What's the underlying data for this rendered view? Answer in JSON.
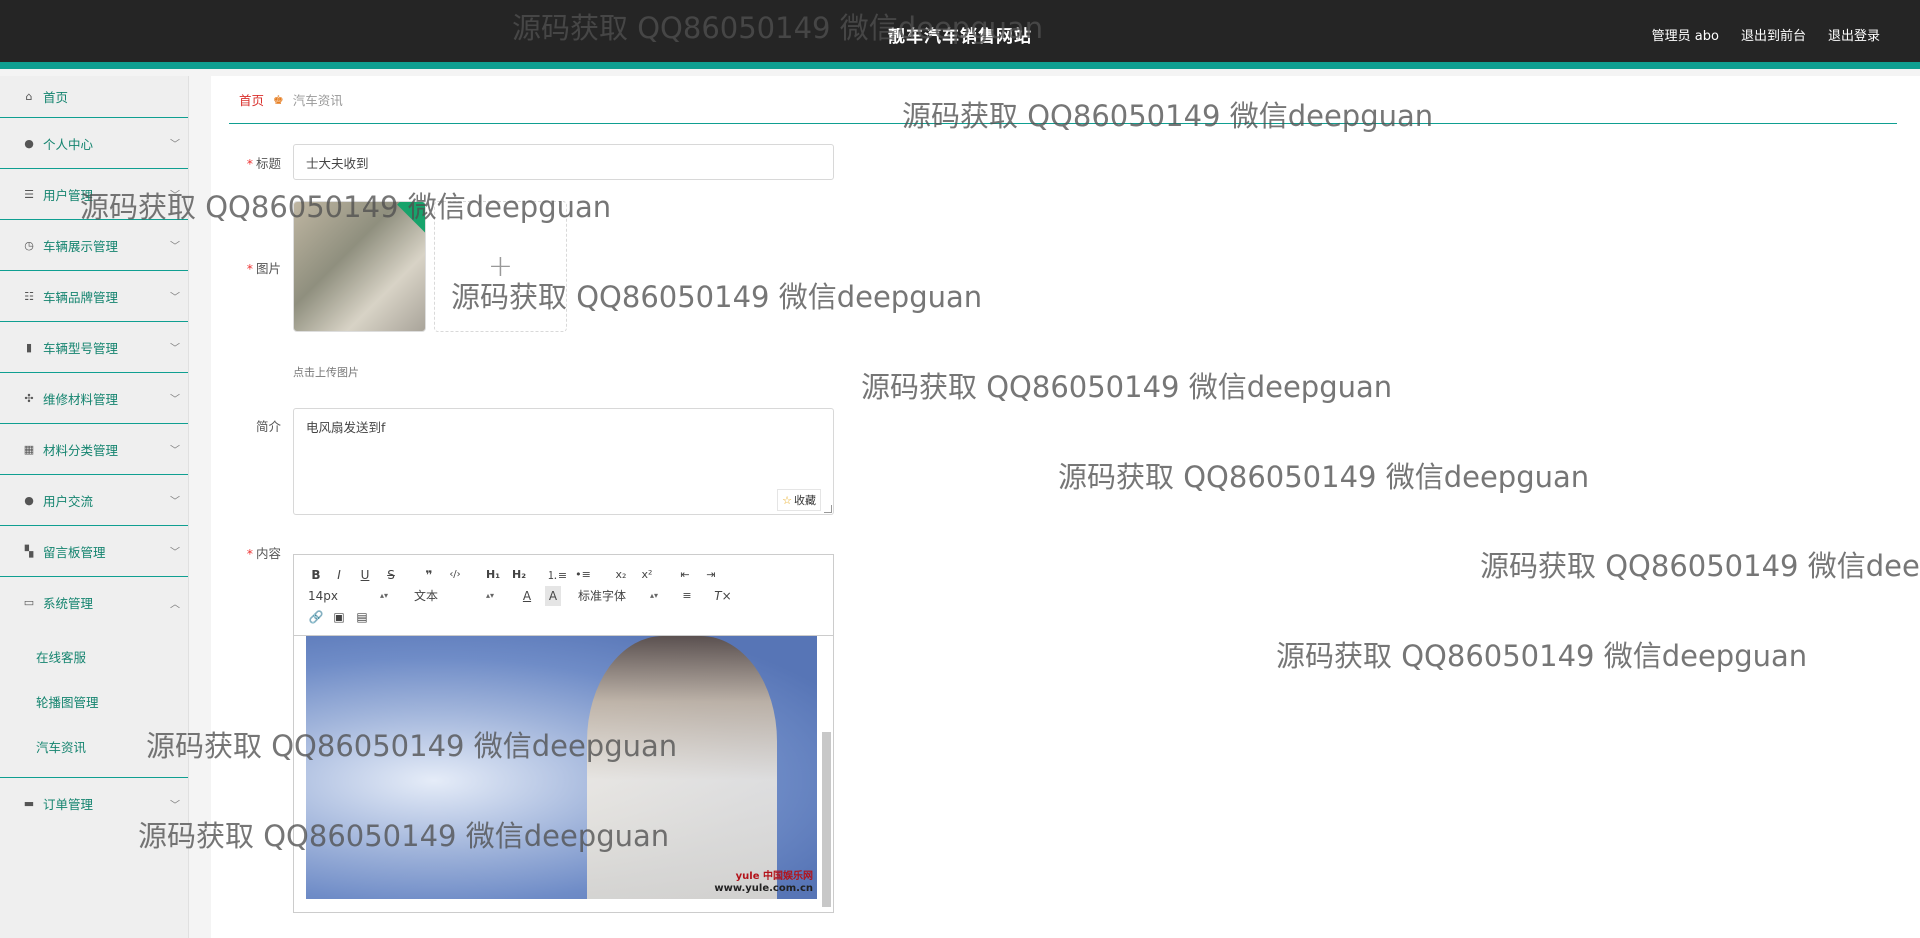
{
  "header": {
    "title": "靓车汽车销售网站",
    "admin_label": "管理员 abo",
    "back_to_front": "退出到前台",
    "logout": "退出登录"
  },
  "sidebar": {
    "items": [
      {
        "label": "首页",
        "icon": "home-icon"
      },
      {
        "label": "个人中心",
        "icon": "user-icon"
      },
      {
        "label": "用户管理",
        "icon": "list-icon"
      },
      {
        "label": "车辆展示管理",
        "icon": "clock-icon"
      },
      {
        "label": "车辆品牌管理",
        "icon": "sliders-icon"
      },
      {
        "label": "车辆型号管理",
        "icon": "mic-icon"
      },
      {
        "label": "维修材料管理",
        "icon": "settings-icon"
      },
      {
        "label": "材料分类管理",
        "icon": "grid-icon"
      },
      {
        "label": "用户交流",
        "icon": "user-icon"
      },
      {
        "label": "留言板管理",
        "icon": "apps-icon"
      },
      {
        "label": "系统管理",
        "icon": "message-icon"
      }
    ],
    "system_sub": [
      "在线客服",
      "轮播图管理",
      "汽车资讯"
    ],
    "last_item": {
      "label": "订单管理",
      "icon": "chat-icon"
    }
  },
  "breadcrumb": {
    "home": "首页",
    "current": "汽车资讯"
  },
  "form": {
    "title_label": "标题",
    "title_value": "士大夫收到",
    "image_label": "图片",
    "upload_hint": "点击上传图片",
    "summary_label": "简介",
    "summary_value": "电风扇发送到f",
    "collect_label": "收藏",
    "content_label": "内容"
  },
  "editor": {
    "font_size": "14px",
    "paragraph": "文本",
    "font_family": "标准字体",
    "image_watermark_line1": "yule 中国娱乐网",
    "image_watermark_line2": "www.yule.com.cn"
  },
  "watermark": "源码获取 QQ86050149 微信deepguan",
  "colors": {
    "accent": "#0f9f91",
    "header_bg": "#252525",
    "menu_text": "#14846f",
    "breadcrumb_home": "#d9302c"
  }
}
